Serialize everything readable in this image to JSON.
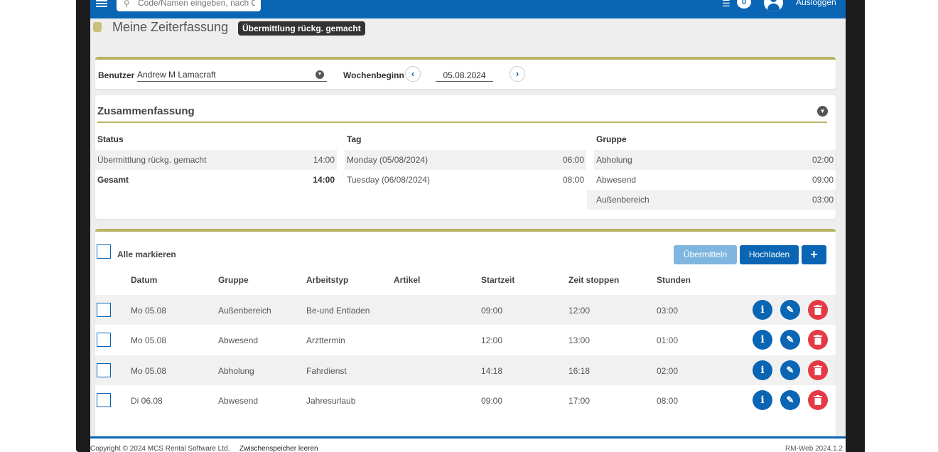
{
  "header": {
    "search_placeholder": "Code/Namen eingeben, nach C",
    "notification_count": "0",
    "logout_label": "Ausloggen"
  },
  "page": {
    "title": "Meine Zeiterfassung",
    "status_badge": "Übermittlung rückg. gemacht"
  },
  "filter": {
    "user_label": "Benutzer",
    "user_value": "Andrew M Lamacraft",
    "week_label": "Wochenbeginn",
    "week_value": "05.08.2024",
    "prev_icon": "‹",
    "next_icon": "›"
  },
  "summary": {
    "title": "Zusammenfassung",
    "headers": {
      "status": "Status",
      "day": "Tag",
      "group": "Gruppe"
    },
    "status_rows": [
      {
        "label": "Übermittlung rückg. gemacht",
        "value": "14:00"
      },
      {
        "label": "Gesamt",
        "value": "14:00"
      }
    ],
    "day_rows": [
      {
        "label": "Monday (05/08/2024)",
        "value": "06:00"
      },
      {
        "label": "Tuesday (06/08/2024)",
        "value": "08:00"
      }
    ],
    "group_rows": [
      {
        "label": "Abholung",
        "value": "02:00"
      },
      {
        "label": "Abwesend",
        "value": "09:00"
      },
      {
        "label": "Außenbereich",
        "value": "03:00"
      }
    ]
  },
  "entries": {
    "select_all_label": "Alle markieren",
    "submit_label": "Übermitteln",
    "upload_label": "Hochladen",
    "add_label": "+",
    "columns": [
      "Datum",
      "Gruppe",
      "Arbeitstyp",
      "Artikel",
      "Startzeit",
      "Zeit stoppen",
      "Stunden"
    ],
    "rows": [
      {
        "date": "Mo 05.08",
        "group": "Außenbereich",
        "worktype": "Be-und Entladen",
        "article": "",
        "start": "09:00",
        "stop": "12:00",
        "hours": "03:00"
      },
      {
        "date": "Mo 05.08",
        "group": "Abwesend",
        "worktype": "Arzttermin",
        "article": "",
        "start": "12:00",
        "stop": "13:00",
        "hours": "01:00"
      },
      {
        "date": "Mo 05.08",
        "group": "Abholung",
        "worktype": "Fahrdienst",
        "article": "",
        "start": "14:18",
        "stop": "16:18",
        "hours": "02:00"
      },
      {
        "date": "Di 06.08",
        "group": "Abwesend",
        "worktype": "Jahresurlaub",
        "article": "",
        "start": "09:00",
        "stop": "17:00",
        "hours": "08:00"
      }
    ]
  },
  "footer": {
    "copyright": "Copyright © 2024 MCS Rental Software Ltd.",
    "clear_cache": "Zwischenspeicher leeren",
    "version": "RM-Web 2024.1.2"
  },
  "colors": {
    "primary": "#0a65b4",
    "accent_line": "#b9b363",
    "delete": "#e53a45",
    "submit_disabled": "#7eb6df"
  }
}
